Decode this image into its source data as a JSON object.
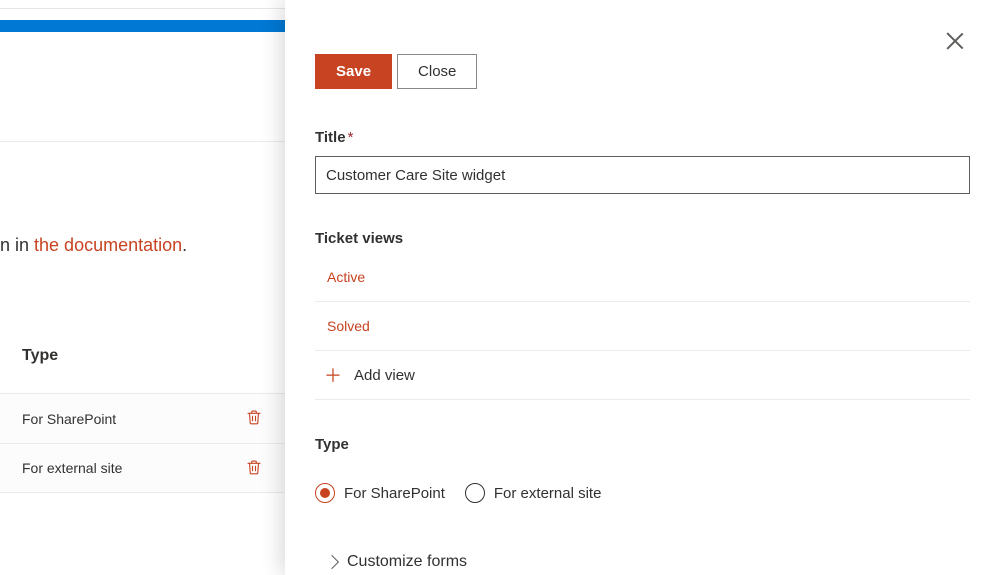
{
  "background": {
    "doc_text_prefix": "n in ",
    "doc_link_text": "the documentation",
    "doc_text_suffix": ".",
    "table_header": "Type",
    "rows": [
      {
        "label": "For SharePoint"
      },
      {
        "label": "For external site"
      }
    ]
  },
  "panel": {
    "save_label": "Save",
    "close_label": "Close",
    "title_label": "Title",
    "title_value": "Customer Care Site widget",
    "ticket_views_label": "Ticket views",
    "views": [
      {
        "label": "Active"
      },
      {
        "label": "Solved"
      }
    ],
    "add_view_label": "Add view",
    "type_label": "Type",
    "radio_sharepoint": "For SharePoint",
    "radio_external": "For external site",
    "customize_label": "Customize forms"
  }
}
